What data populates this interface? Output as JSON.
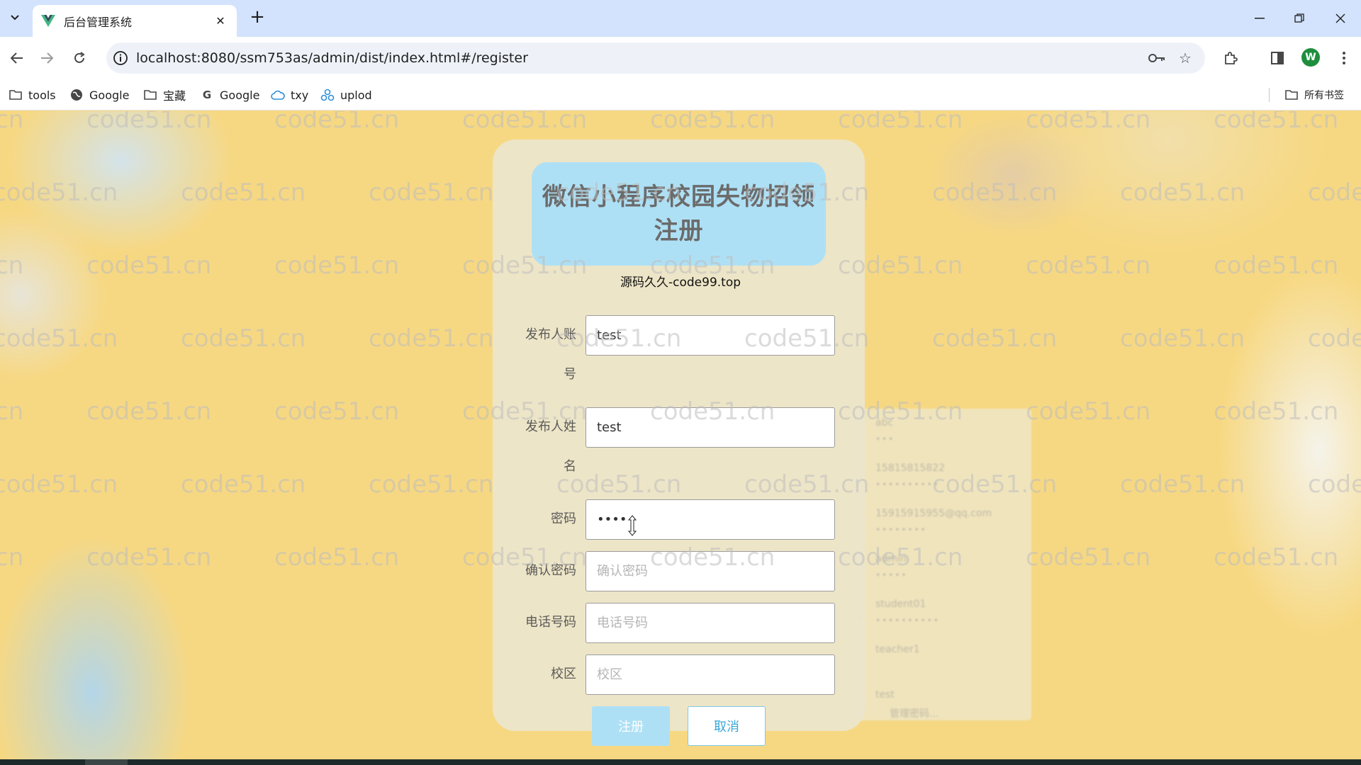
{
  "browser": {
    "tab_title": "后台管理系统",
    "new_tab_label": "+",
    "url": "localhost:8080/ssm753as/admin/dist/index.html#/register",
    "profile_initial": "W"
  },
  "bookmarks": [
    {
      "label": "tools",
      "icon": "folder-icon"
    },
    {
      "label": "Google",
      "icon": "globe-icon"
    },
    {
      "label": "宝藏",
      "icon": "folder-icon"
    },
    {
      "label": "Google",
      "icon": "google-g-icon"
    },
    {
      "label": "txy",
      "icon": "cloud-icon"
    },
    {
      "label": "uplod",
      "icon": "cluster-icon"
    }
  ],
  "all_bookmarks_label": "所有书签",
  "register": {
    "title_line1": "微信小程序校园失物招领",
    "title_line2": "注册",
    "fields": {
      "account": {
        "label_line1": "发布人账",
        "label_line2": "号",
        "value": "test",
        "placeholder": ""
      },
      "name": {
        "label_line1": "发布人姓",
        "label_line2": "名",
        "value": "test",
        "placeholder": ""
      },
      "password": {
        "label": "密码",
        "value": "••••",
        "placeholder": ""
      },
      "confirm": {
        "label": "确认密码",
        "value": "",
        "placeholder": "确认密码"
      },
      "phone": {
        "label": "电话号码",
        "value": "",
        "placeholder": "电话号码"
      },
      "campus": {
        "label": "校区",
        "value": "",
        "placeholder": "校区"
      }
    },
    "submit_label": "注册",
    "cancel_label": "取消"
  },
  "overlay_text": "源码久久-code99.top",
  "watermark_text": "code51.cn",
  "autofill_dropdown": {
    "items": [
      "abc",
      "15815815822",
      "15915915955@qq.com",
      "admin",
      "student01",
      "teacher1",
      "test"
    ],
    "footer": "管理密码..."
  },
  "colors": {
    "page_bg": "#f7d882",
    "panel_bg": "#ece5cc",
    "title_bg": "#aee0f5",
    "accent": "#3aa6d9",
    "tabbar_bg": "#d3e3fd"
  }
}
